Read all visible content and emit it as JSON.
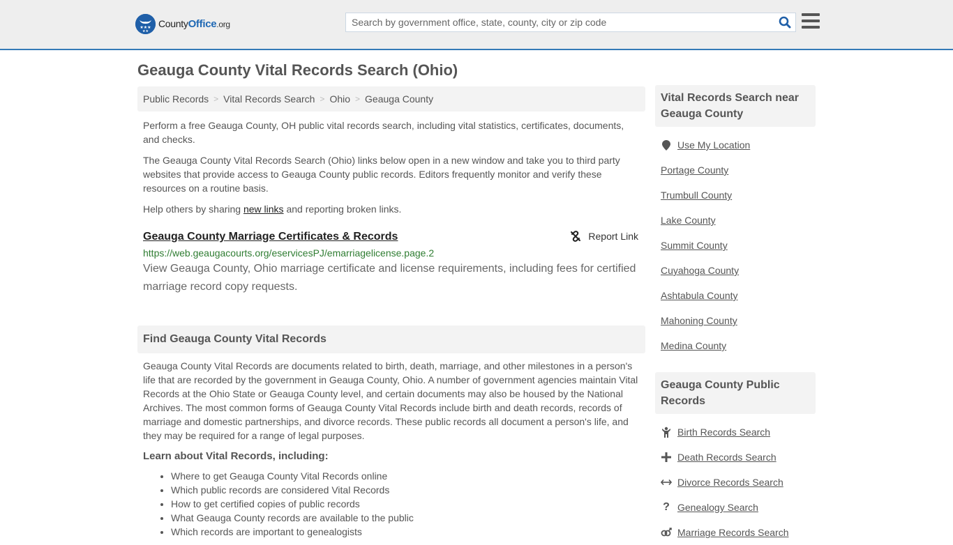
{
  "header": {
    "logo": {
      "name": "County",
      "office": "Office",
      "tld": ".org"
    },
    "search": {
      "placeholder": "Search by government office, state, county, city or zip code",
      "value": ""
    },
    "colors": {
      "accent": "#337ab7",
      "brand": "#1f68b4"
    }
  },
  "page": {
    "title": "Geauga County Vital Records Search (Ohio)"
  },
  "breadcrumb": [
    {
      "label": "Public Records"
    },
    {
      "label": "Vital Records Search"
    },
    {
      "label": "Ohio"
    },
    {
      "label": "Geauga County"
    }
  ],
  "intro": {
    "p1": "Perform a free Geauga County, OH public vital records search, including vital statistics, certificates, documents, and checks.",
    "p2": "The Geauga County Vital Records Search (Ohio) links below open in a new window and take you to third party websites that provide access to Geauga County public records. Editors frequently monitor and verify these resources on a routine basis.",
    "p3_before": "Help others by sharing ",
    "p3_link": "new links",
    "p3_after": " and reporting broken links."
  },
  "results": [
    {
      "title": "Geauga County Marriage Certificates & Records",
      "url": "https://web.geaugacourts.org/eservicesPJ/emarriagelicense.page.2",
      "description": "View Geauga County, Ohio marriage certificate and license requirements, including fees for certified marriage record copy requests.",
      "report_label": "Report Link"
    }
  ],
  "find_section": {
    "heading": "Find Geauga County Vital Records",
    "body": "Geauga County Vital Records are documents related to birth, death, marriage, and other milestones in a person's life that are recorded by the government in Geauga County, Ohio. A number of government agencies maintain Vital Records at the Ohio State or Geauga County level, and certain documents may also be housed by the National Archives. The most common forms of Geauga County Vital Records include birth and death records, records of marriage and domestic partnerships, and divorce records. These public records all document a person's life, and they may be required for a range of legal purposes.",
    "learn_heading": "Learn about Vital Records, including:",
    "learn_items": [
      "Where to get Geauga County Vital Records online",
      "Which public records are considered Vital Records",
      "How to get certified copies of public records",
      "What Geauga County records are available to the public",
      "Which records are important to genealogists"
    ]
  },
  "sidebar": {
    "nearby": {
      "heading": "Vital Records Search near Geauga County",
      "use_location": {
        "label": "Use My Location",
        "icon": "map-marker-icon"
      },
      "items": [
        "Portage County",
        "Trumbull County",
        "Lake County",
        "Summit County",
        "Cuyahoga County",
        "Ashtabula County",
        "Mahoning County",
        "Medina County"
      ]
    },
    "public_records": {
      "heading": "Geauga County Public Records",
      "items": [
        {
          "label": "Birth Records Search",
          "icon": "baby-icon"
        },
        {
          "label": "Death Records Search",
          "icon": "cross-icon"
        },
        {
          "label": "Divorce Records Search",
          "icon": "arrows-horizontal-icon"
        },
        {
          "label": "Genealogy Search",
          "icon": "question-icon"
        },
        {
          "label": "Marriage Records Search",
          "icon": "gender-icon"
        }
      ]
    }
  }
}
